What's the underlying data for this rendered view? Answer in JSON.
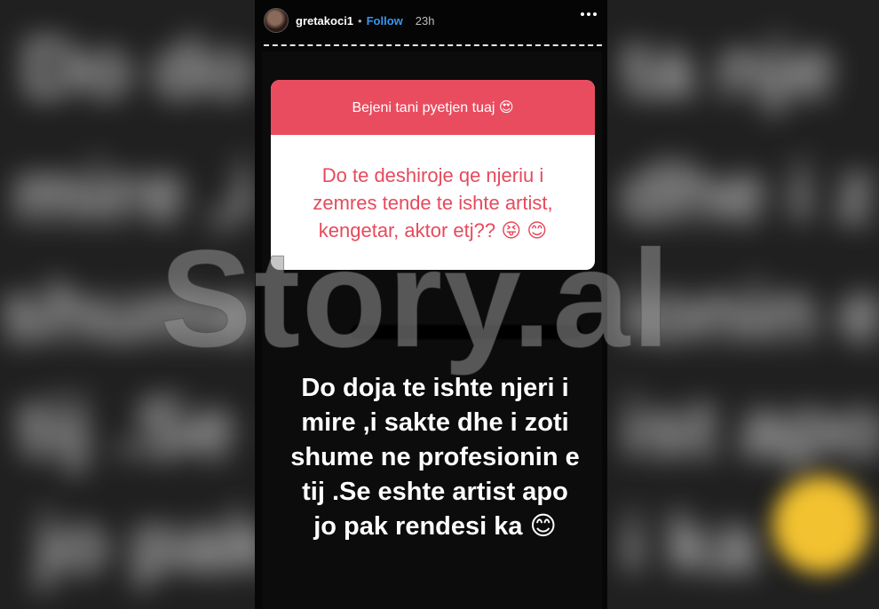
{
  "header": {
    "username": "gretakoci1",
    "separator": "•",
    "follow_label": "Follow",
    "time": "23h",
    "more_icon": "more-horizontal-icon"
  },
  "sticker": {
    "prompt": "Bejeni tani pyetjen tuaj 😍",
    "question": "Do te deshiroje qe njeriu i zemres tende te ishte artist, kengetar, aktor etj?? 😝 😊"
  },
  "answer": {
    "lines": [
      "Do doja te ishte njeri i",
      "mire ,i sakte  dhe i zoti",
      "shume ne profesionin e",
      "tij .Se eshte artist apo",
      "jo pak rendesi ka 😊"
    ]
  },
  "watermark": "Story.al",
  "colors": {
    "accent": "#ea4c5f",
    "follow": "#3897f0"
  }
}
